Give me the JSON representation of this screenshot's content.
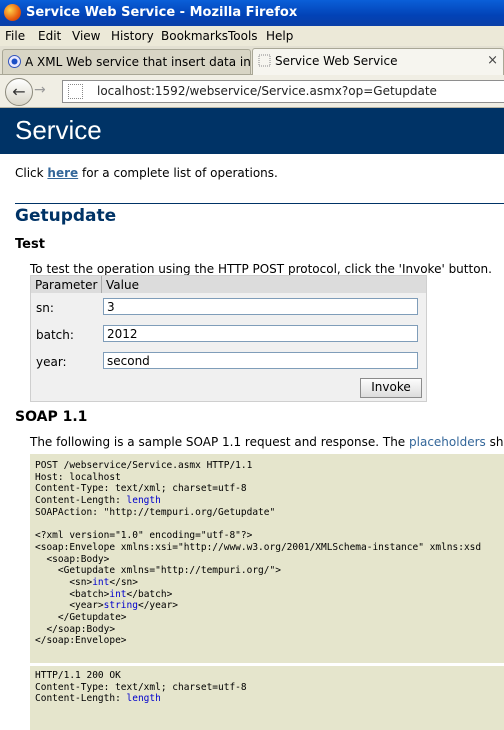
{
  "window": {
    "title": "Service Web Service - Mozilla Firefox"
  },
  "menu": [
    "File",
    "Edit",
    "View",
    "History",
    "Bookmarks",
    "Tools",
    "Help"
  ],
  "tabs": [
    {
      "label": "A XML Web service that insert data into ...",
      "close": "×"
    },
    {
      "label": "Service Web Service",
      "close": "×"
    }
  ],
  "nav": {
    "url": "localhost:1592/webservice/Service.asmx?op=Getupdate",
    "back": "←",
    "forward": "→"
  },
  "page": {
    "header": "Service",
    "intro_before": "Click ",
    "intro_link": "here",
    "intro_after": " for a complete list of operations.",
    "operation": "Getupdate",
    "test_heading": "Test",
    "test_desc": "To test the operation using the HTTP POST protocol, click the 'Invoke' button.",
    "form": {
      "col_param": "Parameter",
      "col_value": "Value",
      "params": [
        {
          "label": "sn:",
          "value": "3"
        },
        {
          "label": "batch:",
          "value": "2012"
        },
        {
          "label": "year:",
          "value": "second"
        }
      ],
      "invoke": "Invoke"
    },
    "soap_heading": "SOAP 1.1",
    "soap_desc_before": "The following is a sample SOAP 1.1 request and response. The ",
    "soap_desc_link": "placeholders",
    "soap_desc_after": " shown"
  },
  "request_lines": [
    [
      {
        "t": "POST /webservice/Service.asmx HTTP/1.1"
      }
    ],
    [
      {
        "t": "Host: localhost"
      }
    ],
    [
      {
        "t": "Content-Type: text/xml; charset=utf-8"
      }
    ],
    [
      {
        "t": "Content-Length: "
      },
      {
        "t": "length",
        "ph": true
      }
    ],
    [
      {
        "t": "SOAPAction: \"http://tempuri.org/Getupdate\""
      }
    ],
    [
      {
        "t": ""
      }
    ],
    [
      {
        "t": "<?xml version=\"1.0\" encoding=\"utf-8\"?>"
      }
    ],
    [
      {
        "t": "<soap:Envelope xmlns:xsi=\"http://www.w3.org/2001/XMLSchema-instance\" xmlns:xsd"
      }
    ],
    [
      {
        "t": "  <soap:Body>"
      }
    ],
    [
      {
        "t": "    <Getupdate xmlns=\"http://tempuri.org/\">"
      }
    ],
    [
      {
        "t": "      <sn>"
      },
      {
        "t": "int",
        "ph": true
      },
      {
        "t": "</sn>"
      }
    ],
    [
      {
        "t": "      <batch>"
      },
      {
        "t": "int",
        "ph": true
      },
      {
        "t": "</batch>"
      }
    ],
    [
      {
        "t": "      <year>"
      },
      {
        "t": "string",
        "ph": true
      },
      {
        "t": "</year>"
      }
    ],
    [
      {
        "t": "    </Getupdate>"
      }
    ],
    [
      {
        "t": "  </soap:Body>"
      }
    ],
    [
      {
        "t": "</soap:Envelope>"
      }
    ]
  ],
  "response_lines": [
    [
      {
        "t": "HTTP/1.1 200 OK"
      }
    ],
    [
      {
        "t": "Content-Type: text/xml; charset=utf-8"
      }
    ],
    [
      {
        "t": "Content-Length: "
      },
      {
        "t": "length",
        "ph": true
      }
    ]
  ]
}
